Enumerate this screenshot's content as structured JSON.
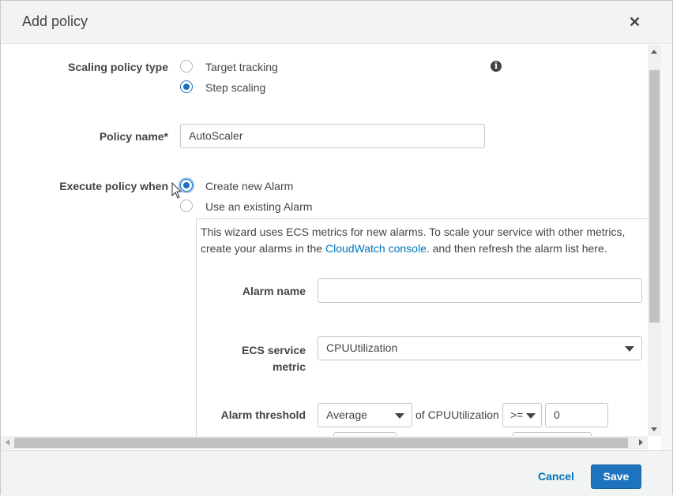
{
  "dialog": {
    "title": "Add policy",
    "close_glyph": "✕"
  },
  "form": {
    "scaling_policy_type": {
      "label": "Scaling policy type",
      "options": [
        {
          "label": "Target tracking",
          "selected": false
        },
        {
          "label": "Step scaling",
          "selected": true
        }
      ],
      "info_icon": "info-icon"
    },
    "policy_name": {
      "label": "Policy name*",
      "value": "AutoScaler"
    },
    "execute_policy_when": {
      "label": "Execute policy when",
      "options": [
        {
          "label": "Create new Alarm",
          "selected": true
        },
        {
          "label": "Use an existing Alarm",
          "selected": false
        }
      ]
    },
    "wizard": {
      "text_before_link": "This wizard uses ECS metrics for new alarms. To scale your service with other metrics, create your alarms in the ",
      "link_text": "CloudWatch console",
      "text_after_link": ". and then refresh the alarm list here.",
      "alarm_name": {
        "label": "Alarm name",
        "value": ""
      },
      "ecs_service_metric": {
        "label_line1": "ECS service",
        "label_line2": "metric",
        "value": "CPUUtilization"
      },
      "alarm_threshold": {
        "label": "Alarm threshold",
        "statistic": "Average",
        "of_text": "of CPUUtilization",
        "operator": ">=",
        "value": "0"
      }
    }
  },
  "footer": {
    "cancel_label": "Cancel",
    "save_label": "Save"
  },
  "colors": {
    "accent": "#1e73be",
    "link": "#0073bb",
    "header_bg": "#f2f3f3"
  }
}
